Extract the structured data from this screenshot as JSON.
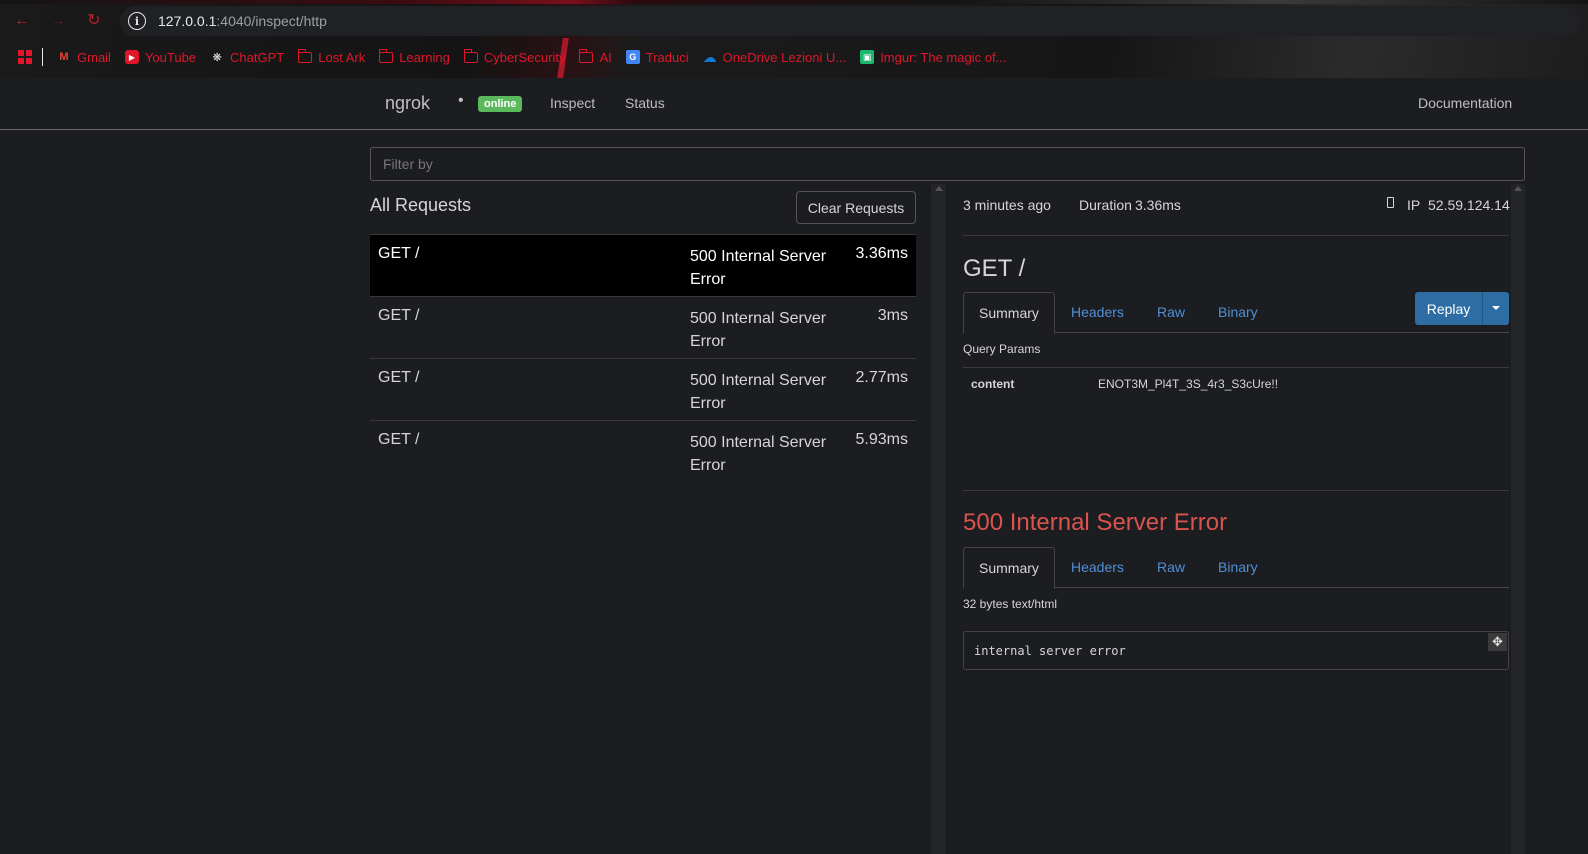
{
  "browser": {
    "url_host": "127.0.0.1",
    "url_path": ":4040/inspect/http",
    "bookmarks": [
      {
        "label": "Gmail",
        "icon": "gmail-icon"
      },
      {
        "label": "YouTube",
        "icon": "youtube-icon"
      },
      {
        "label": "ChatGPT",
        "icon": "chatgpt-icon"
      },
      {
        "label": "Lost Ark",
        "icon": "folder-icon"
      },
      {
        "label": "Learning",
        "icon": "folder-icon"
      },
      {
        "label": "CyberSecurity",
        "icon": "folder-icon"
      },
      {
        "label": "AI",
        "icon": "folder-icon"
      },
      {
        "label": "Traduci",
        "icon": "translate-icon"
      },
      {
        "label": "OneDrive Lezioni U...",
        "icon": "onedrive-icon"
      },
      {
        "label": "Imgur: The magic of...",
        "icon": "imgur-icon"
      }
    ],
    "accent_color": "#e0162b"
  },
  "nav": {
    "brand": "ngrok",
    "status_badge": "online",
    "links": [
      "Inspect",
      "Status"
    ],
    "documentation": "Documentation"
  },
  "filter": {
    "placeholder": "Filter by"
  },
  "requests": {
    "title": "All Requests",
    "clear_label": "Clear Requests",
    "rows": [
      {
        "method": "GET /",
        "status": "500 Internal Server Error",
        "duration": "3.36ms",
        "selected": true
      },
      {
        "method": "GET /",
        "status": "500 Internal Server Error",
        "duration": "3ms",
        "selected": false
      },
      {
        "method": "GET /",
        "status": "500 Internal Server Error",
        "duration": "2.77ms",
        "selected": false
      },
      {
        "method": "GET /",
        "status": "500 Internal Server Error",
        "duration": "5.93ms",
        "selected": false
      }
    ]
  },
  "detail": {
    "time_ago": "3 minutes ago",
    "duration_label": "Duration",
    "duration_value": "3.36ms",
    "ip_label": "IP",
    "ip_value": "52.59.124.14",
    "request_title": "GET /",
    "tabs": [
      "Summary",
      "Headers",
      "Raw",
      "Binary"
    ],
    "replay_label": "Replay",
    "query_params_label": "Query Params",
    "params": [
      {
        "key": "content",
        "value": "ENOT3M_Pl4T_3S_4r3_S3cUre!!"
      }
    ],
    "response_title": "500 Internal Server Error",
    "response_tabs": [
      "Summary",
      "Headers",
      "Raw",
      "Binary"
    ],
    "response_meta": "32 bytes text/html",
    "response_body": "internal server error",
    "error_color": "#d9534f",
    "link_color": "#4f8fd6",
    "badge_color": "#5cb85c"
  }
}
